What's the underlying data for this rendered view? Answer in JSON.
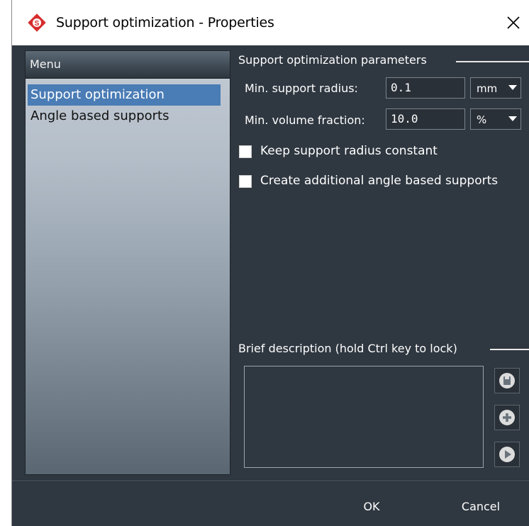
{
  "window": {
    "title": "Support optimization - Properties",
    "close_icon": "close-icon",
    "logo_icon": "app-logo-icon"
  },
  "menu": {
    "header": "Menu",
    "items": [
      {
        "label": "Support optimization",
        "selected": true
      },
      {
        "label": "Angle based supports",
        "selected": false
      }
    ]
  },
  "params": {
    "section_title": "Support optimization parameters",
    "min_radius": {
      "label": "Min. support radius:",
      "value": "0.1",
      "unit": "mm"
    },
    "min_volume": {
      "label": "Min. volume fraction:",
      "value": "10.0",
      "unit": "%"
    },
    "keep_radius": {
      "label": "Keep support radius constant",
      "checked": false
    },
    "create_angle": {
      "label": "Create additional angle based supports",
      "checked": false
    }
  },
  "description": {
    "section_title": "Brief description (hold Ctrl key to lock)",
    "text": "",
    "buttons": [
      "save-icon",
      "add-icon",
      "play-icon"
    ]
  },
  "footer": {
    "ok_label": "OK",
    "cancel_label": "Cancel"
  },
  "colors": {
    "background": "#2f3740",
    "selection": "#4a7cb5",
    "logo_red": "#d62c2c"
  }
}
